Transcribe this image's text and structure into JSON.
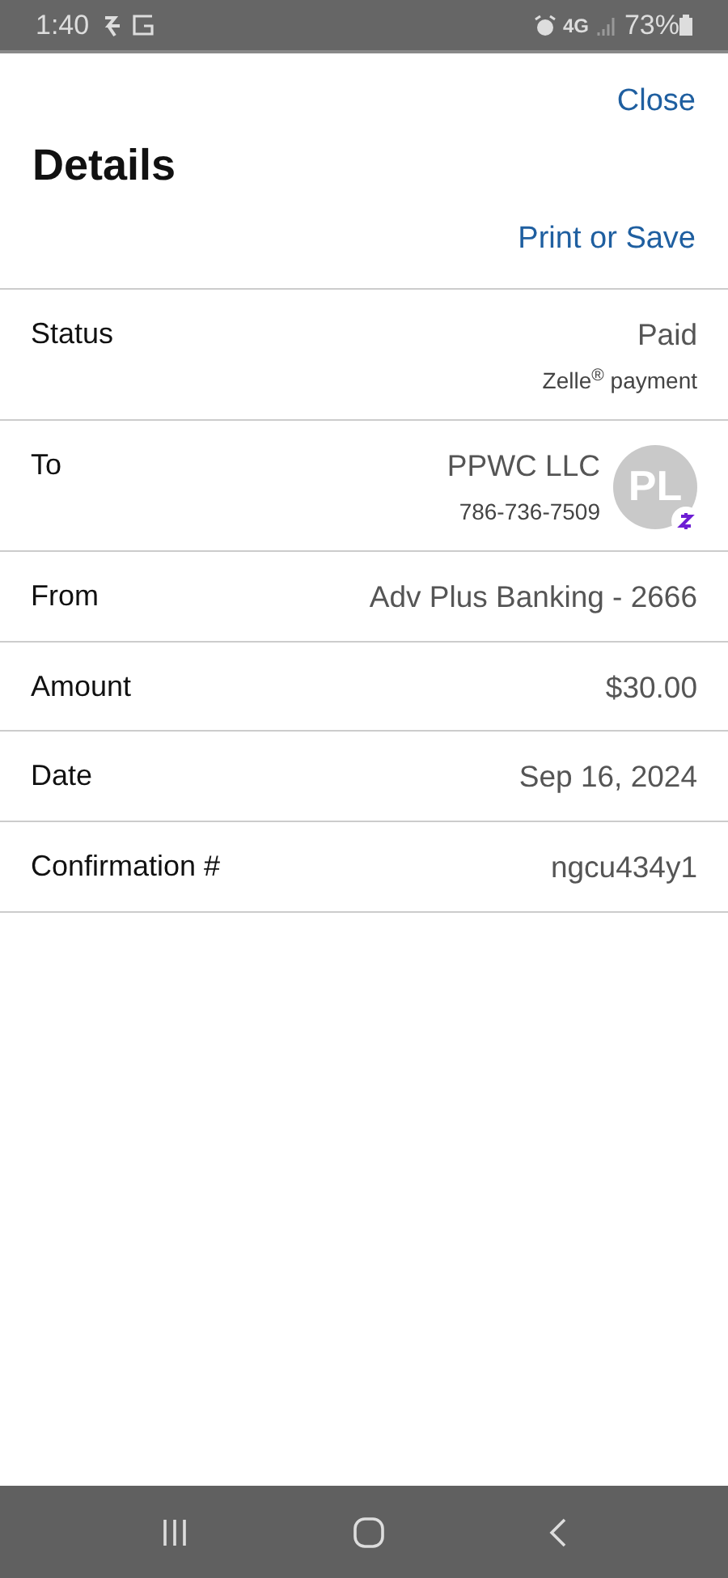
{
  "status_bar": {
    "time": "1:40",
    "network": "4G",
    "battery": "73%"
  },
  "header": {
    "close": "Close",
    "title": "Details",
    "print": "Print or Save"
  },
  "rows": [
    {
      "kind": "plain",
      "label": "Status",
      "value": "Paid",
      "subtext": "Zelle$^{®}$ payment"
    },
    {
      "kind": "contact",
      "label": "To",
      "value": "PPWC LLC",
      "subtext": "786-736-7509",
      "initials": "PL"
    },
    {
      "kind": "plain",
      "label": "From",
      "value": "Adv Plus Banking - 2666"
    },
    {
      "kind": "plain",
      "label": "Amount",
      "value": "$30.00"
    },
    {
      "kind": "plain",
      "label": "Date",
      "value": "Sep 16, 2024"
    },
    {
      "kind": "plain",
      "label": "Confirmation #",
      "value": "ngcu434y1"
    }
  ]
}
